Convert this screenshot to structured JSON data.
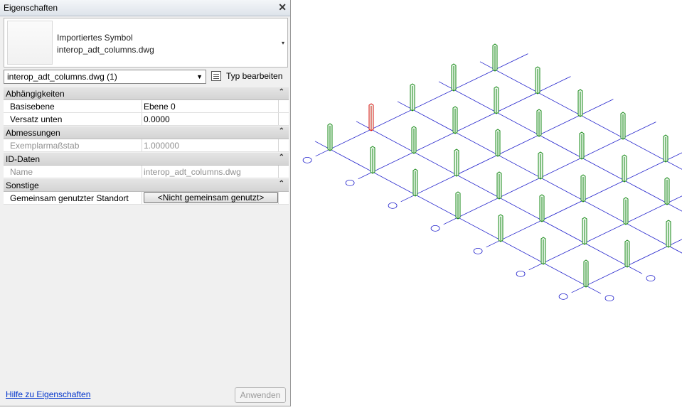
{
  "panel": {
    "title": "Eigenschaften",
    "close_glyph": "✕",
    "type": {
      "family": "Importiertes Symbol",
      "name": "interop_adt_columns.dwg",
      "dropdown_glyph": "▾"
    },
    "selector": {
      "value": "interop_adt_columns.dwg (1)",
      "arrow": "▼"
    },
    "edit_type_label": "Typ bearbeiten",
    "groups": [
      {
        "label": "Abhängigkeiten",
        "chev": "⌃",
        "rows": [
          {
            "key": "Basisebene",
            "value": "Ebene 0"
          },
          {
            "key": "Versatz unten",
            "value": "0.0000"
          }
        ]
      },
      {
        "label": "Abmessungen",
        "chev": "⌃",
        "rows": [
          {
            "key": "Exemplarmaßstab",
            "value": "1.000000"
          }
        ]
      },
      {
        "label": "ID-Daten",
        "chev": "⌃",
        "rows": [
          {
            "key": "Name",
            "value": "interop_adt_columns.dwg"
          }
        ]
      },
      {
        "label": "Sonstige",
        "chev": "⌃",
        "rows": [
          {
            "key": "Gemeinsam genutzter Standort",
            "button": "<Nicht gemeinsam genutzt>"
          }
        ]
      }
    ],
    "help_link": "Hilfe zu Eigenschaften",
    "apply_label": "Anwenden"
  },
  "view": {
    "grid_color": "#2222cc",
    "column_color": "#1a8a1a",
    "selected_column_color": "#dd1111"
  }
}
